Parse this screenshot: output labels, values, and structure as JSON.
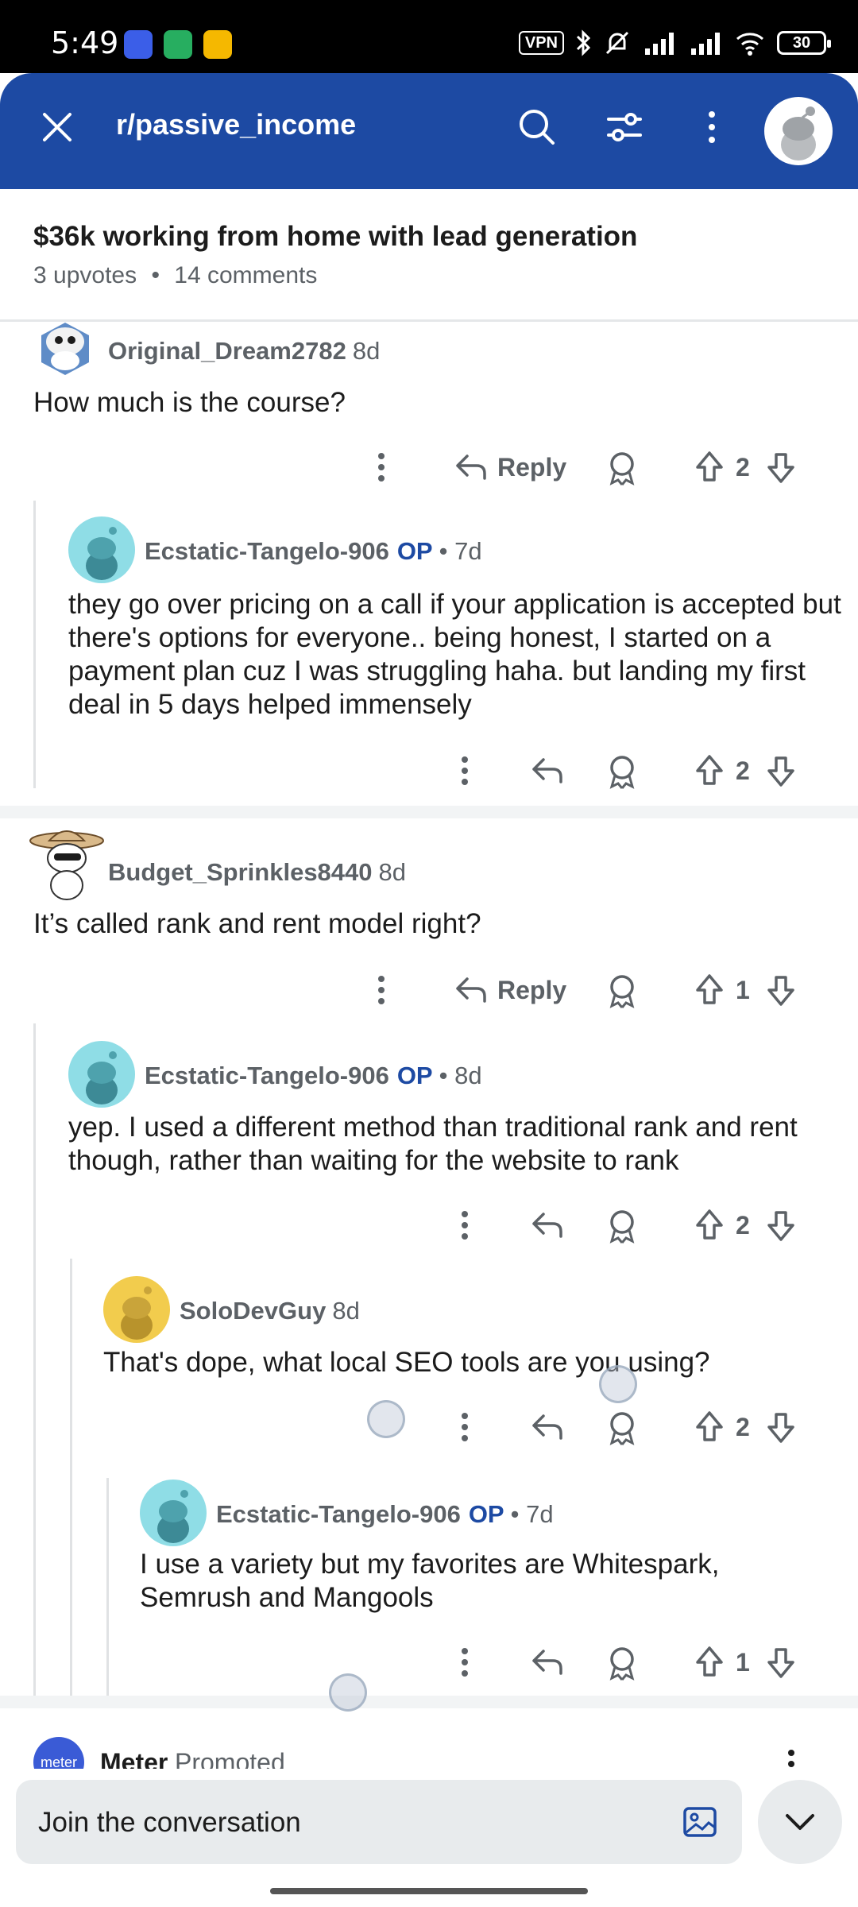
{
  "status_bar": {
    "time": "5:49",
    "vpn_label": "VPN",
    "battery": "30",
    "notif_colors": [
      "#3b5ee8",
      "#27ae60",
      "#f5b800"
    ]
  },
  "header": {
    "subreddit": "r/passive_income",
    "icons": [
      "close-icon",
      "search-icon",
      "filter-icon",
      "more-vert-icon",
      "avatar"
    ],
    "color": "#1d4aa3"
  },
  "post": {
    "title": "$36k working from home with lead generation",
    "upvotes": "3 upvotes",
    "comments": "14 comments"
  },
  "comments": [
    {
      "user": "Original_Dream2782",
      "op": "",
      "age": "8d",
      "text": "How much is the course?",
      "reply_label": "Reply",
      "votes": "2"
    },
    {
      "user": "Ecstatic-Tangelo-906",
      "op": "OP",
      "age": "• 7d",
      "text": "they go over pricing on a call if your application is accepted but there's options for everyone.. being honest, I started on a payment plan cuz I was struggling haha. but landing my first deal in 5 days helped immensely",
      "votes": "2"
    },
    {
      "user": "Budget_Sprinkles8440",
      "op": "",
      "age": "8d",
      "text": "It’s called rank and rent model right?",
      "reply_label": "Reply",
      "votes": "1"
    },
    {
      "user": "Ecstatic-Tangelo-906",
      "op": "OP",
      "age": "• 8d",
      "text": "yep. I used a different method than traditional rank and rent though, rather than waiting for the website to rank",
      "votes": "2"
    },
    {
      "user": "SoloDevGuy",
      "op": "",
      "age": "8d",
      "text": "That's dope, what local SEO tools are you using?",
      "votes": "2"
    },
    {
      "user": "Ecstatic-Tangelo-906",
      "op": "OP",
      "age": "• 7d",
      "text": "I use a variety but my favorites are Whitespark, Semrush and Mangools",
      "votes": "1"
    }
  ],
  "promoted": {
    "avatar_text": "meter",
    "name": "Meter",
    "tag": "Promoted"
  },
  "composer": {
    "placeholder": "Join the conversation"
  }
}
